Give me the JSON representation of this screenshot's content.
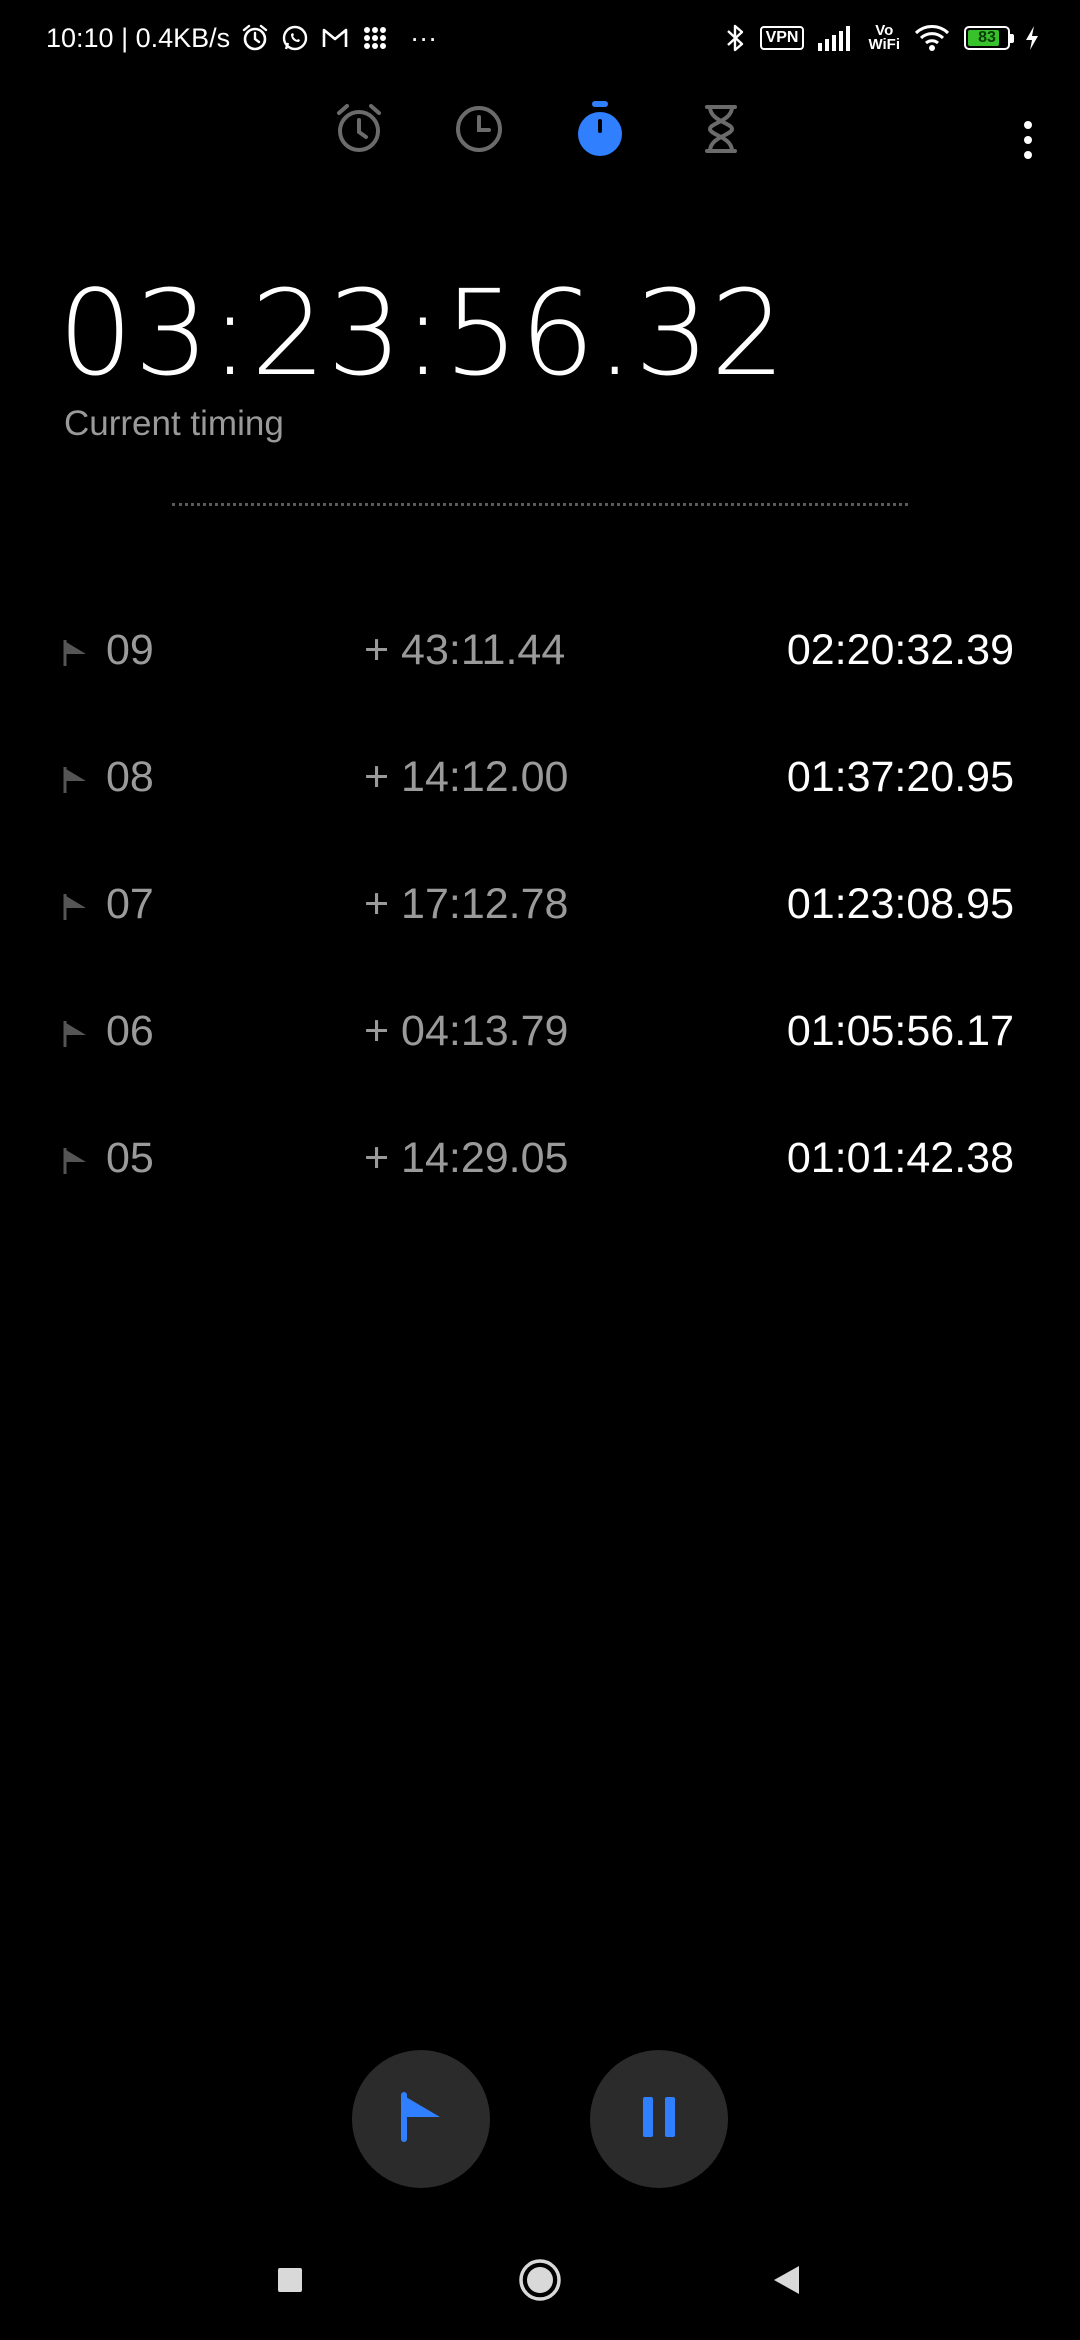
{
  "status_bar": {
    "time_speed": "10:10 | 0.4KB/s",
    "dots": "···",
    "vpn": "VPN",
    "vowifi_top": "Vo",
    "vowifi_bottom": "WiFi",
    "battery": "83",
    "battery_level": 0.83
  },
  "tabs": [
    {
      "icon": "alarm-icon",
      "active": false
    },
    {
      "icon": "clock-icon",
      "active": false
    },
    {
      "icon": "stopwatch-icon",
      "active": true
    },
    {
      "icon": "hourglass-icon",
      "active": false
    }
  ],
  "stopwatch": {
    "current_time": "03:23:56.32",
    "current_label": "Current timing"
  },
  "laps": [
    {
      "number": "09",
      "diff": "+ 43:11.44",
      "total": "02:20:32.39"
    },
    {
      "number": "08",
      "diff": "+ 14:12.00",
      "total": "01:37:20.95"
    },
    {
      "number": "07",
      "diff": "+ 17:12.78",
      "total": "01:23:08.95"
    },
    {
      "number": "06",
      "diff": "+ 04:13.79",
      "total": "01:05:56.17"
    },
    {
      "number": "05",
      "diff": "+ 14:29.05",
      "total": "01:01:42.38"
    }
  ],
  "colors": {
    "accent": "#2f7fff",
    "inactive_icon": "#6b6b6b",
    "button_bg": "#2b2b2b",
    "button_icon": "#2f7fff"
  }
}
